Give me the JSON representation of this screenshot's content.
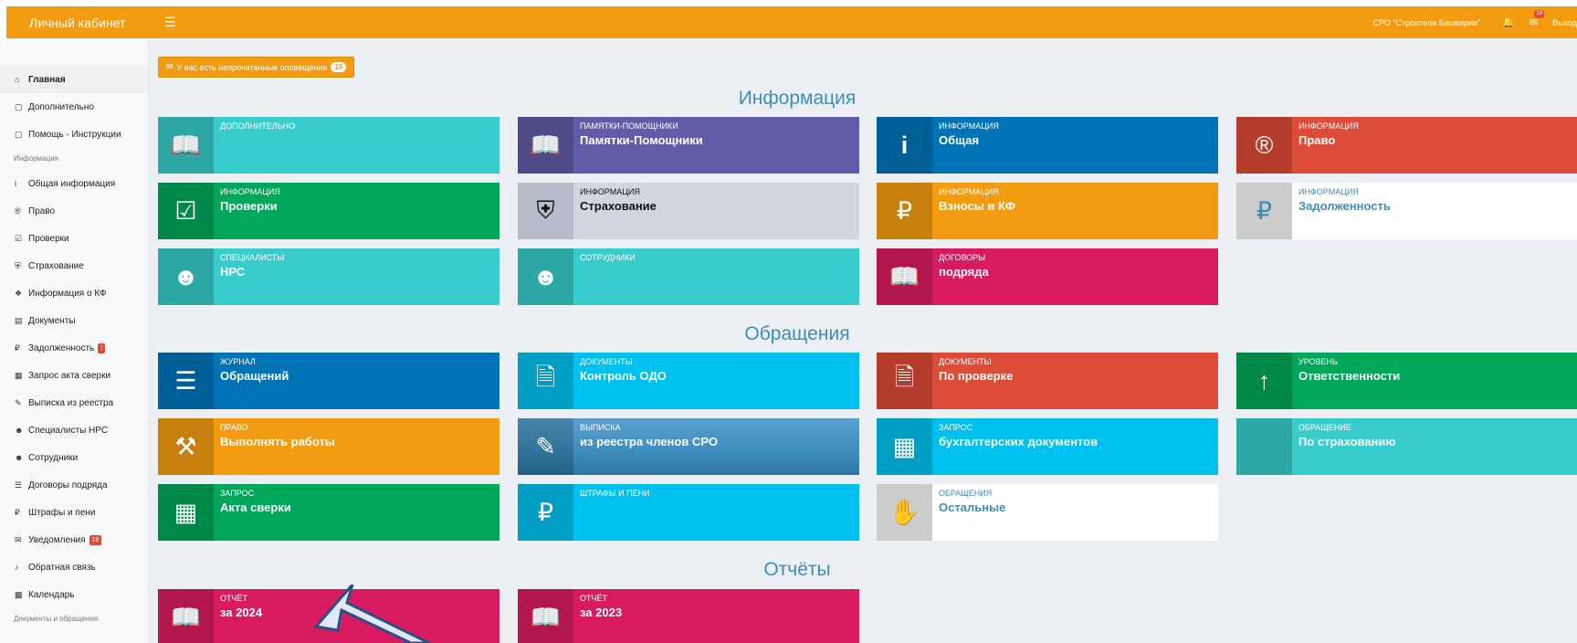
{
  "topbar": {
    "brand": "Личный кабинет",
    "menu_icon": "hamburger-icon",
    "org_name": "СРО \"Строители Башкирии\"",
    "mail_count": "19",
    "logout": "Выход"
  },
  "sidebar": {
    "items": [
      {
        "label": "Главная",
        "icon": "home-icon",
        "active": true
      },
      {
        "label": "Дополнительно",
        "icon": "book-icon"
      },
      {
        "label": "Помощь - Инструкции",
        "icon": "book-icon"
      }
    ],
    "header_info": "Информация",
    "info_items": [
      {
        "label": "Общая информация",
        "icon": "info-icon"
      },
      {
        "label": "Право",
        "icon": "registered-icon"
      },
      {
        "label": "Проверки",
        "icon": "calendar-check-icon"
      },
      {
        "label": "Страхование",
        "icon": "shield-icon"
      },
      {
        "label": "Информация о КФ",
        "icon": "info-circle-icon"
      },
      {
        "label": "Документы",
        "icon": "file-icon"
      },
      {
        "label": "Задолженность",
        "icon": "ruble-icon",
        "badge": "!"
      },
      {
        "label": "Запрос акта сверки",
        "icon": "calculator-icon"
      },
      {
        "label": "Выписка из реестра",
        "icon": "edit-icon"
      },
      {
        "label": "Специалисты НРС",
        "icon": "users-icon"
      },
      {
        "label": "Сотрудники",
        "icon": "users-icon"
      },
      {
        "label": "Договоры подряда",
        "icon": "list-icon"
      },
      {
        "label": "Штрафы и пени",
        "icon": "ruble-icon"
      },
      {
        "label": "Уведомления",
        "icon": "envelope-icon",
        "badge": "19"
      },
      {
        "label": "Обратная связь",
        "icon": "bell-icon"
      },
      {
        "label": "Календарь",
        "icon": "calendar-icon"
      }
    ],
    "header_docs": "Документы и обращения"
  },
  "alert": {
    "text": "У вас есть непрочитанные оповещения",
    "count": "19"
  },
  "sections": {
    "info": "Информация",
    "requests": "Обращения",
    "reports": "Отчёты"
  },
  "tiles": {
    "info": [
      {
        "cap": "ДОПОЛНИТЕЛЬНО",
        "name": "",
        "icon": "book-icon",
        "color": "#39cccc"
      },
      {
        "cap": "ПАМЯТКИ-ПОМОЩНИКИ",
        "name": "Памятки-Помощники",
        "icon": "book-icon",
        "color": "#605ca8"
      },
      {
        "cap": "ИНФОРМАЦИЯ",
        "name": "Общая",
        "icon": "info-icon",
        "color": "#0073b7"
      },
      {
        "cap": "ИНФОРМАЦИЯ",
        "name": "Право",
        "icon": "registered-icon",
        "color": "#dd4b39"
      },
      {
        "cap": "ИНФОРМАЦИЯ",
        "name": "Проверки",
        "icon": "calendar-check-icon",
        "color": "#00a65a"
      },
      {
        "cap": "ИНФОРМАЦИЯ",
        "name": "Страхование",
        "icon": "shield-icon",
        "color": "#d2d6de"
      },
      {
        "cap": "ИНФОРМАЦИЯ",
        "name": "Взносы в КФ",
        "icon": "ruble-icon",
        "color": "#f39c12"
      },
      {
        "cap": "ИНФОРМАЦИЯ",
        "name": "Задолженность",
        "icon": "ruble-icon",
        "color": "#ffffff"
      },
      {
        "cap": "СПЕЦИАЛИСТЫ",
        "name": "НРС",
        "icon": "users-icon",
        "color": "#39cccc"
      },
      {
        "cap": "СОТРУДНИКИ",
        "name": "",
        "icon": "users-icon",
        "color": "#39cccc"
      },
      {
        "cap": "ДОГОВОРЫ",
        "name": "подряда",
        "icon": "book-icon",
        "color": "#d81b60"
      }
    ],
    "requests": [
      {
        "cap": "ЖУРНАЛ",
        "name": "Обращений",
        "icon": "list-icon",
        "color": "#0073b7"
      },
      {
        "cap": "ДОКУМЕНТЫ",
        "name": "Контроль ОДО",
        "icon": "file-icon",
        "color": "#00c0ef"
      },
      {
        "cap": "ДОКУМЕНТЫ",
        "name": "По проверке",
        "icon": "file-icon",
        "color": "#dd4b39"
      },
      {
        "cap": "УРОВЕНЬ",
        "name": "Ответственности",
        "icon": "level-up-icon",
        "color": "#00a65a"
      },
      {
        "cap": "ПРАВО",
        "name": "Выполнять работы",
        "icon": "gavel-icon",
        "color": "#f39c12"
      },
      {
        "cap": "ВЫПИСКА",
        "name": "из реестра членов СРО",
        "icon": "edit-icon",
        "color": "#3c8dbc"
      },
      {
        "cap": "ЗАПРОС",
        "name": "бухгалтерских документов",
        "icon": "calculator-icon",
        "color": "#00c0ef"
      },
      {
        "cap": "ОБРАЩЕНИЕ",
        "name": "По страхованию",
        "icon": "blank",
        "color": "#39cccc"
      },
      {
        "cap": "ЗАПРОС",
        "name": "Акта сверки",
        "icon": "calculator-icon",
        "color": "#00a65a"
      },
      {
        "cap": "ШТРАФЫ И ПЕНИ",
        "name": "",
        "icon": "ruble-icon",
        "color": "#00c0ef"
      },
      {
        "cap": "ОБРАЩЕНИЯ",
        "name": "Остальные",
        "icon": "hand-icon",
        "color": "#ffffff"
      }
    ],
    "reports": [
      {
        "cap": "ОТЧЁТ",
        "name": "за 2024",
        "icon": "book-icon",
        "color": "#d81b60"
      },
      {
        "cap": "ОТЧЁТ",
        "name": "за 2023",
        "icon": "book-icon",
        "color": "#d81b60"
      }
    ]
  }
}
